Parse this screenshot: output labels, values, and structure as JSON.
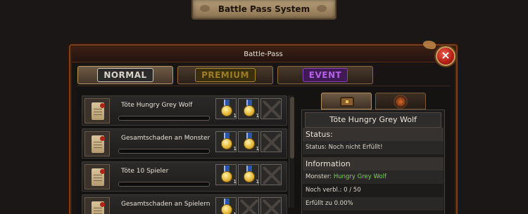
{
  "header": {
    "title": "Battle Pass System"
  },
  "window": {
    "title": "Battle-Pass",
    "close_label": "×"
  },
  "tabs": [
    {
      "label": "NORMAL",
      "active": true,
      "color": "#d9d4ca"
    },
    {
      "label": "PREMIUM",
      "active": false,
      "color": "#9b7d25"
    },
    {
      "label": "EVENT",
      "active": false,
      "color": "#b560e6"
    }
  ],
  "missions": [
    {
      "name": "Töte Hungry Grey Wolf",
      "progress": 0.0,
      "rewards": [
        {
          "type": "medal",
          "count": "1"
        },
        {
          "type": "medal",
          "count": "1"
        },
        {
          "type": "locked"
        }
      ]
    },
    {
      "name": "Gesamtschaden an Monster",
      "progress": 0.0,
      "rewards": [
        {
          "type": "medal",
          "count": "1"
        },
        {
          "type": "medal",
          "count": "1"
        },
        {
          "type": "locked"
        }
      ]
    },
    {
      "name": "Töte 10 Spieler",
      "progress": 0.0,
      "rewards": [
        {
          "type": "medal",
          "count": "1"
        },
        {
          "type": "medal",
          "count": "1"
        },
        {
          "type": "locked"
        }
      ]
    },
    {
      "name": "Gesamtschaden an Spielern",
      "progress": 0.0,
      "rewards": [
        {
          "type": "medal",
          "count": "1"
        },
        {
          "type": "locked"
        },
        {
          "type": "locked"
        }
      ]
    }
  ],
  "detail_tabs": [
    {
      "icon": "chest-icon",
      "active": true
    },
    {
      "icon": "sun-emblem-icon",
      "active": false
    }
  ],
  "detail": {
    "title": "Töte Hungry Grey Wolf",
    "status_heading": "Status:",
    "status_label": "Status:",
    "status_value": "Noch nicht Erfüllt!",
    "info_heading": "Information",
    "monster_label": "Monster:",
    "monster_value": "Hungry Grey Wolf",
    "remaining_label": "Noch verbl.:",
    "remaining_value": "0 / 50",
    "fulfilled_label": "Erfüllt zu",
    "fulfilled_value": "0.00%"
  }
}
